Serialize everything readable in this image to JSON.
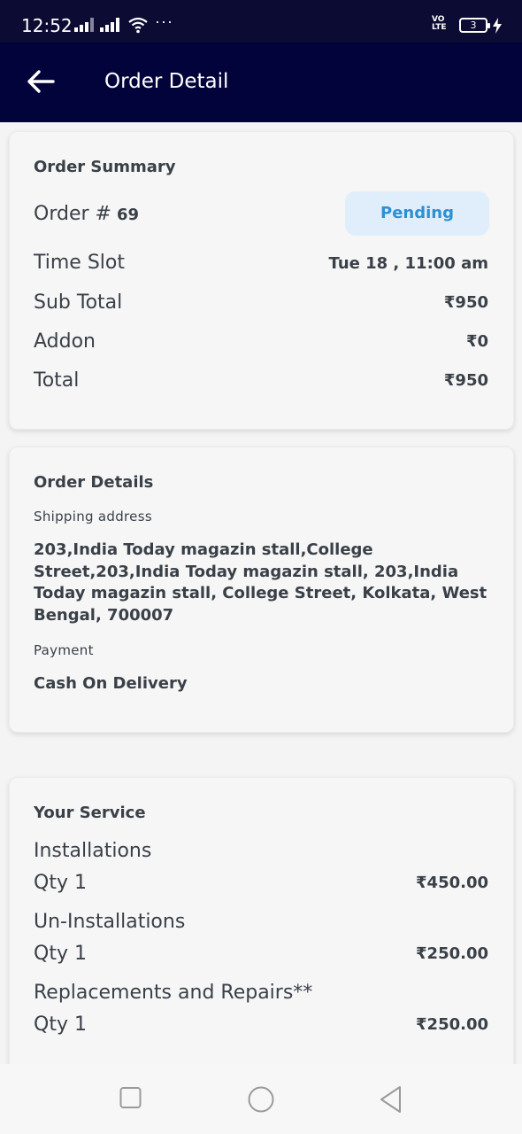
{
  "status_bar": {
    "time": "12:52",
    "more": "···",
    "volte_top": "VO",
    "volte_bottom": "LTE",
    "battery": "3"
  },
  "app_bar": {
    "title": "Order Detail"
  },
  "order_summary": {
    "title": "Order Summary",
    "order_label": "Order #",
    "order_number": "69",
    "status": "Pending",
    "rows": [
      {
        "label": "Time Slot",
        "value": "Tue 18 , 11:00 am"
      },
      {
        "label": "Sub Total",
        "value": "₹950"
      },
      {
        "label": "Addon",
        "value": "₹0"
      },
      {
        "label": "Total",
        "value": "₹950"
      }
    ]
  },
  "order_details": {
    "title": "Order Details",
    "shipping_label": "Shipping address",
    "shipping_address": "203,India Today magazin stall,College Street,203,India Today magazin stall, 203,India Today magazin stall, College Street, Kolkata, West Bengal, 700007",
    "payment_label": "Payment",
    "payment_value": "Cash On Delivery"
  },
  "your_service": {
    "title": "Your Service",
    "items": [
      {
        "name": "Installations",
        "qty": "Qty 1",
        "price": "₹450.00"
      },
      {
        "name": "Un-Installations",
        "qty": "Qty 1",
        "price": "₹250.00"
      },
      {
        "name": "Replacements and Repairs**",
        "qty": "Qty 1",
        "price": "₹250.00"
      }
    ]
  },
  "icons": {
    "back": "arrow-left-icon",
    "recents": "square-icon",
    "home": "circle-icon",
    "nav_back": "triangle-back-icon"
  },
  "colors": {
    "header": "#03033b",
    "badge_bg": "#e0eefb",
    "badge_text": "#2d8fd3"
  }
}
